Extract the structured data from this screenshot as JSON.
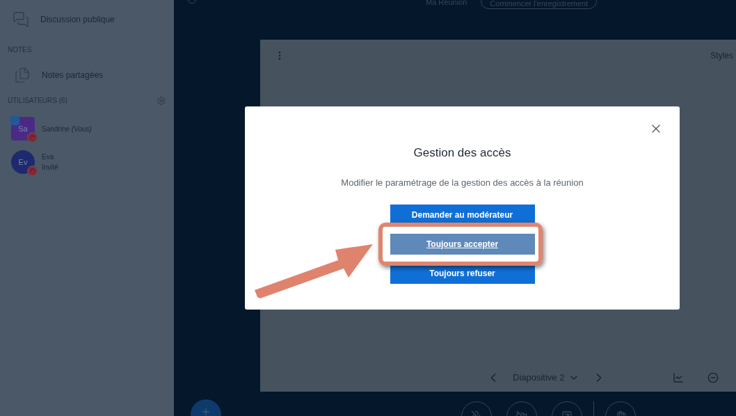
{
  "sidebar": {
    "chat": {
      "label": "Discussion publique"
    },
    "notes": {
      "heading": "NOTES",
      "label": "Notes partagées"
    },
    "users": {
      "heading": "UTILISATEURS (6)",
      "items": [
        {
          "initials": "Sa",
          "name": "Sandrine",
          "suffix": "(Vous)",
          "presenter": true,
          "color": "#4b2a86"
        },
        {
          "initials": "Ev",
          "name": "Eva",
          "role": "Invité",
          "presenter": false,
          "color": "#1e2a6e"
        }
      ]
    }
  },
  "topbar": {
    "title": "Ma Réunion",
    "record": "Commencer l'enregistrement"
  },
  "slide": {
    "styles": "Styles",
    "label": "Diapositive 2"
  },
  "dialog": {
    "title": "Gestion des accès",
    "description": "Modifier le paramétrage de la gestion des accès à la réunion",
    "options": [
      {
        "label": "Demander au modérateur",
        "selected": false
      },
      {
        "label": "Toujours accepter",
        "selected": true
      },
      {
        "label": "Toujours refuser",
        "selected": false
      }
    ]
  }
}
